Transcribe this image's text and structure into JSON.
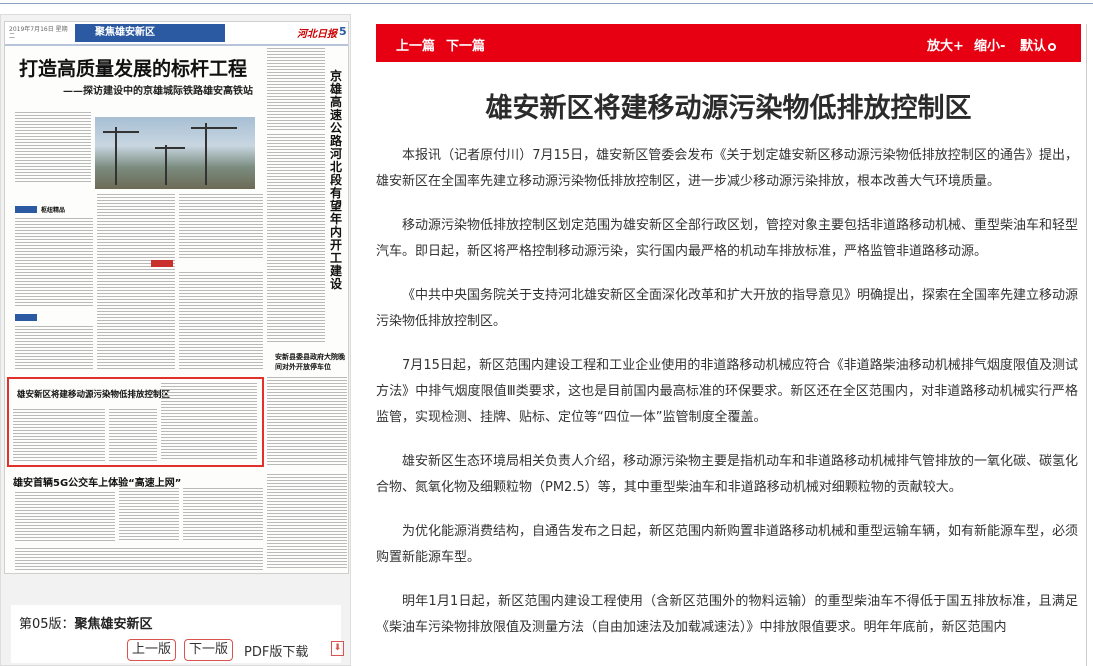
{
  "newspaper_thumbnail": {
    "date_line": "2019年7月16日 星期二",
    "section_name": "聚焦雄安新区",
    "brand": "河北日报",
    "page_number": "5",
    "main_headline": "打造高质量发展的标杆工程",
    "main_subheadline": "——探访建设中的京雄城际铁路雄安高铁站",
    "vertical_headline": "京雄高速公路河北段有望年内开工建设",
    "side_headline": "安新县委县政府大院晚间对外开放停车位",
    "highlighted_headline": "雄安新区将建移动源污染物低排放控制区",
    "bottom_headline": "雄安首辆5G公交车上体验“高速上网”"
  },
  "pager": {
    "page_label": "第05版：",
    "section_name": "聚焦雄安新区",
    "prev_label": "上一版",
    "next_label": "下一版",
    "pdf_label": "PDF版下载",
    "pdf_icon": "pdf-icon"
  },
  "toolbar": {
    "prev_article": "上一篇",
    "next_article": "下一篇",
    "zoom_in": "放大+",
    "zoom_out": "缩小-",
    "default_size": "默认",
    "accent_color": "#e60012"
  },
  "article": {
    "title": "雄安新区将建移动源污染物低排放控制区",
    "paragraphs": [
      "本报讯（记者原付川）7月15日，雄安新区管委会发布《关于划定雄安新区移动源污染物低排放控制区的通告》提出，雄安新区在全国率先建立移动源污染物低排放控制区，进一步减少移动源污染排放，根本改善大气环境质量。",
      "移动源污染物低排放控制区划定范围为雄安新区全部行政区划，管控对象主要包括非道路移动机械、重型柴油车和轻型汽车。即日起，新区将严格控制移动源污染，实行国内最严格的机动车排放标准，严格监管非道路移动源。",
      "《中共中央国务院关于支持河北雄安新区全面深化改革和扩大开放的指导意见》明确提出，探索在全国率先建立移动源污染物低排放控制区。",
      "7月15日起，新区范围内建设工程和工业企业使用的非道路移动机械应符合《非道路柴油移动机械排气烟度限值及测试方法》中排气烟度限值Ⅲ类要求，这也是目前国内最高标准的环保要求。新区还在全区范围内，对非道路移动机械实行严格监管，实现检测、挂牌、贴标、定位等“四位一体”监管制度全覆盖。",
      "雄安新区生态环境局相关负责人介绍，移动源污染物主要是指机动车和非道路移动机械排气管排放的一氧化碳、碳氢化合物、氮氧化物及细颗粒物（PM2.5）等，其中重型柴油车和非道路移动机械对细颗粒物的贡献较大。",
      "为优化能源消费结构，自通告发布之日起，新区范围内新购置非道路移动机械和重型运输车辆，如有新能源车型，必须购置新能源车型。",
      "明年1月1日起，新区范围内建设工程使用（含新区范围外的物料运输）的重型柴油车不得低于国五排放标准，且满足《柴油车污染物排放限值及测量方法（自由加速法及加载减速法）》中排放限值要求。明年年底前，新区范围内"
    ]
  }
}
